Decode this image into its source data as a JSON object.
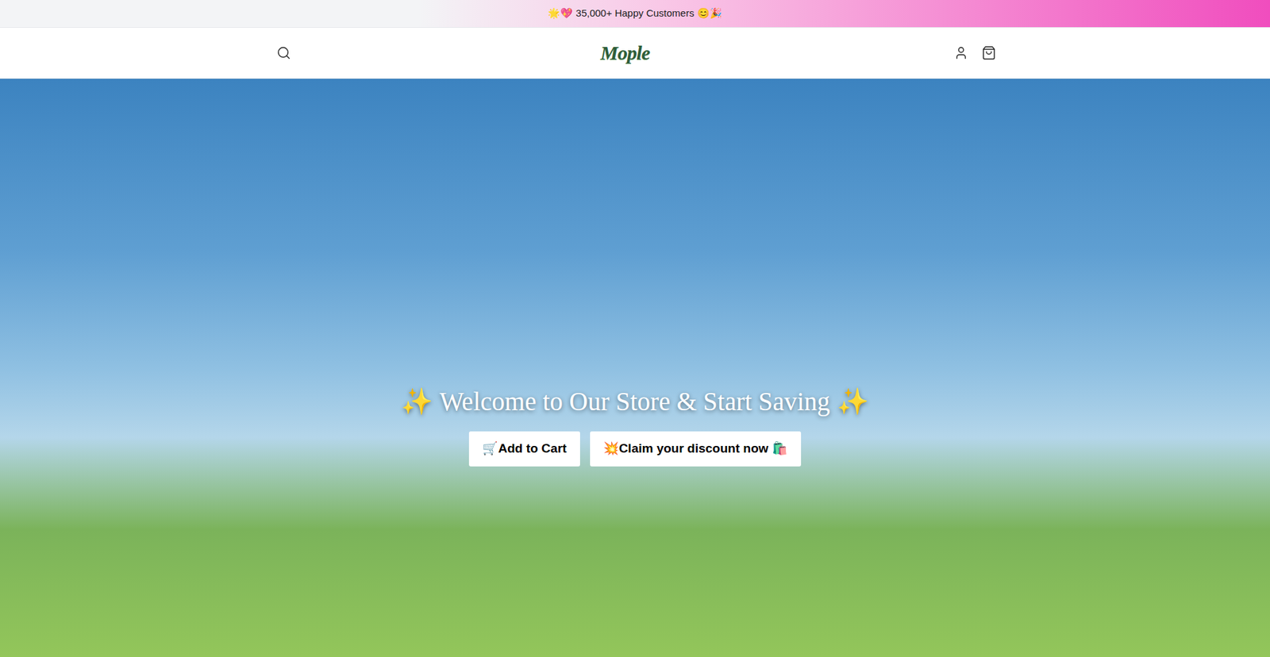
{
  "announcement": {
    "text": "🌟💖 35,000+ Happy Customers 😊🎉"
  },
  "header": {
    "logo": "Mople"
  },
  "hero": {
    "heading": "✨ Welcome to Our Store & Start Saving ✨",
    "buttons": [
      {
        "label": "🛒Add to Cart"
      },
      {
        "label": "💥Claim your discount now 🛍️"
      }
    ]
  }
}
